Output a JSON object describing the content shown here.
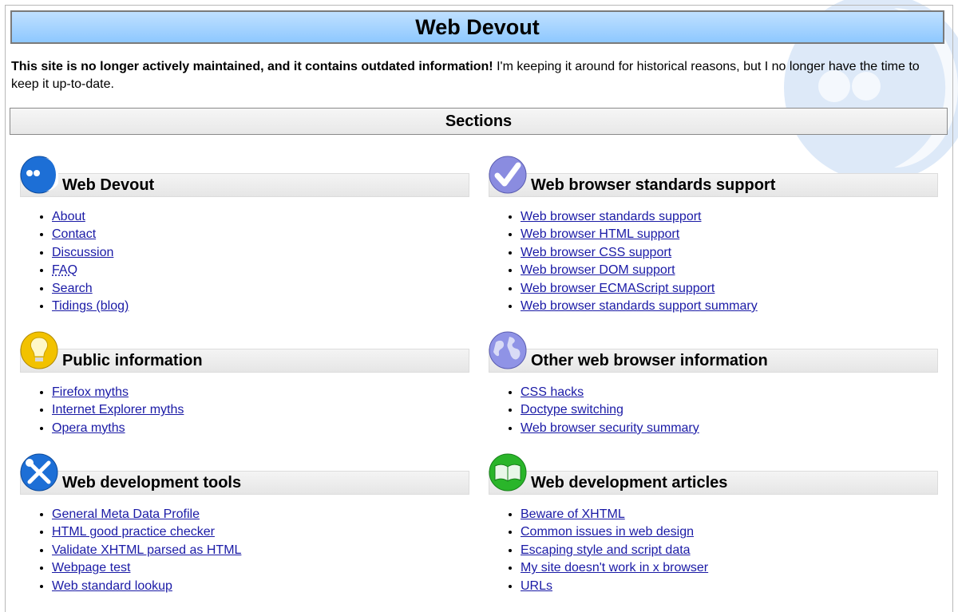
{
  "site_title": "Web Devout",
  "notice": {
    "bold": "This site is no longer actively maintained, and it contains outdated information!",
    "rest": " I'm keeping it around for historical reasons, but I no longer have the time to keep it up-to-date."
  },
  "sections_label": "Sections",
  "colors": {
    "link": "#1a1aa6",
    "title_bar": "#8ec8ff"
  },
  "sections": [
    {
      "title": "Web Devout",
      "icon": "web-devout-logo-icon",
      "links": [
        "About",
        "Contact",
        "Discussion",
        "FAQ",
        "Search",
        "Tidings (blog)"
      ]
    },
    {
      "title": "Web browser standards support",
      "icon": "checkmark-icon",
      "links": [
        "Web browser standards support",
        "Web browser HTML support",
        "Web browser CSS support",
        "Web browser DOM support",
        "Web browser ECMAScript support",
        "Web browser standards support summary"
      ]
    },
    {
      "title": "Public information",
      "icon": "lightbulb-icon",
      "links": [
        "Firefox myths",
        "Internet Explorer myths",
        "Opera myths"
      ]
    },
    {
      "title": "Other web browser information",
      "icon": "globe-icon",
      "links": [
        "CSS hacks",
        "Doctype switching",
        "Web browser security summary"
      ]
    },
    {
      "title": "Web development tools",
      "icon": "wrench-screwdriver-icon",
      "links": [
        "General Meta Data Profile",
        "HTML good practice checker",
        "Validate XHTML parsed as HTML",
        "Webpage test",
        "Web standard lookup"
      ]
    },
    {
      "title": "Web development articles",
      "icon": "book-icon",
      "links": [
        "Beware of XHTML",
        "Common issues in web design",
        "Escaping style and script data",
        "My site doesn't work in x browser",
        "URLs"
      ]
    }
  ]
}
